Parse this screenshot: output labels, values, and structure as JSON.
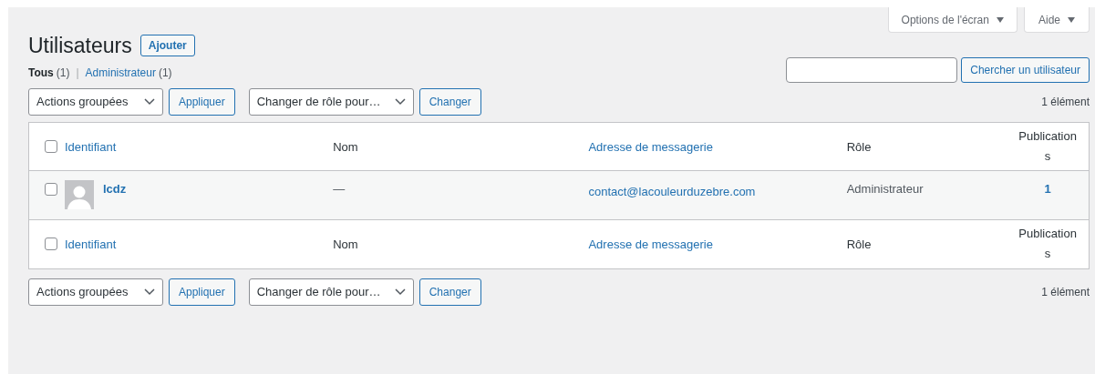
{
  "screen_meta": {
    "screen_options": "Options de l'écran",
    "help": "Aide"
  },
  "title": "Utilisateurs",
  "add_button": "Ajouter",
  "filter_separator": "|",
  "filters": [
    {
      "label": "Tous",
      "count": "(1)",
      "selected": true
    },
    {
      "label": "Administrateur",
      "count": "(1)",
      "selected": false
    }
  ],
  "search": {
    "button": "Chercher un utilisateur"
  },
  "top_nav": {
    "bulk_actions": "Actions groupées",
    "apply": "Appliquer",
    "change_role": "Changer de rôle pour…",
    "change": "Changer",
    "count": "1 élément"
  },
  "table": {
    "header": [
      {
        "label": "Identifiant",
        "checked": false
      },
      {
        "label": "Nom"
      },
      {
        "label": "Adresse de messagerie"
      },
      {
        "label": "Rôle"
      },
      {
        "label": "Publications"
      }
    ],
    "rows": [
      {
        "checked": false,
        "username": "lcdz",
        "name": "—",
        "email": "contact@lacouleurduzebre.com",
        "role": "Administrateur",
        "posts": "1"
      }
    ],
    "footer": [
      {
        "label": "Identifiant",
        "checked": false
      },
      {
        "label": "Nom"
      },
      {
        "label": "Adresse de messagerie"
      },
      {
        "label": "Rôle"
      },
      {
        "label": "Publications"
      }
    ]
  },
  "bottom_nav": {
    "bulk_actions": "Actions groupées",
    "apply": "Appliquer",
    "change_role": "Changer de rôle pour…",
    "change": "Changer",
    "count": "1 élément"
  }
}
